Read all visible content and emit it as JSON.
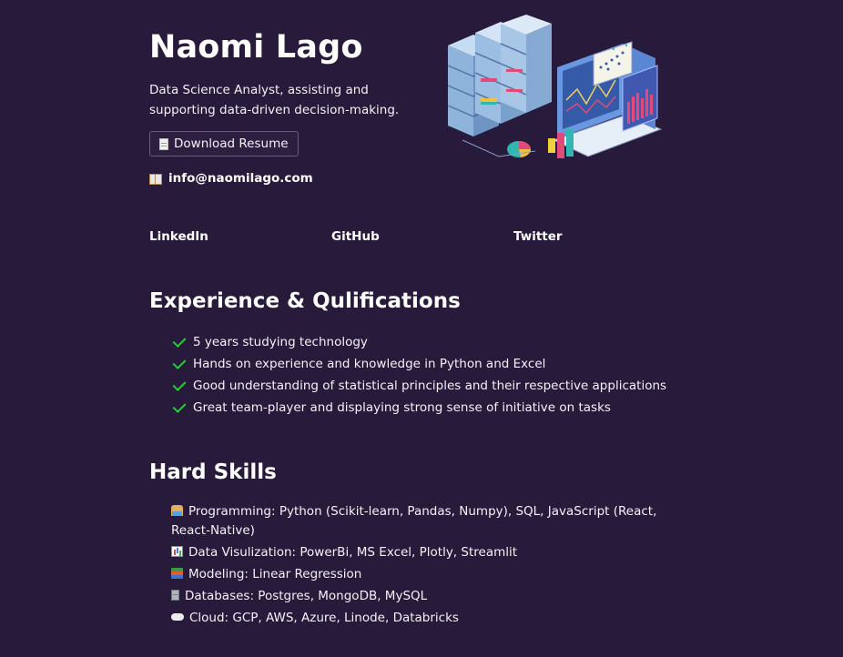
{
  "profile": {
    "name": "Naomi Lago",
    "tagline": "Data Science Analyst, assisting and supporting data-driven decision-making.",
    "resume_button": "Download Resume",
    "email": "info@naomilago.com"
  },
  "icons": {
    "resume": "document-icon",
    "email": "open-book-icon",
    "hero": "data-servers-laptop-illustration"
  },
  "social": [
    "LinkedIn",
    "GitHub",
    "Twitter"
  ],
  "experience": {
    "title": "Experience & Qulifications",
    "items": [
      "5 years studying technology",
      "Hands on experience and knowledge in Python and Excel",
      "Good understanding of statistical principles and their respective applications",
      "Great team-player and displaying strong sense of initiative on tasks"
    ]
  },
  "skills": {
    "title": "Hard Skills",
    "items": [
      "Programming: Python (Scikit-learn, Pandas, Numpy), SQL, JavaScript (React, React-Native)",
      "Data Visulization: PowerBi, MS Excel, Plotly, Streamlit",
      "Modeling: Linear Regression",
      "Databases: Postgres, MongoDB, MySQL",
      "Cloud: GCP, AWS, Azure, Linode, Databricks"
    ]
  },
  "colors": {
    "background": "#281a3a",
    "check": "#2ec840",
    "text": "#ffffff"
  }
}
